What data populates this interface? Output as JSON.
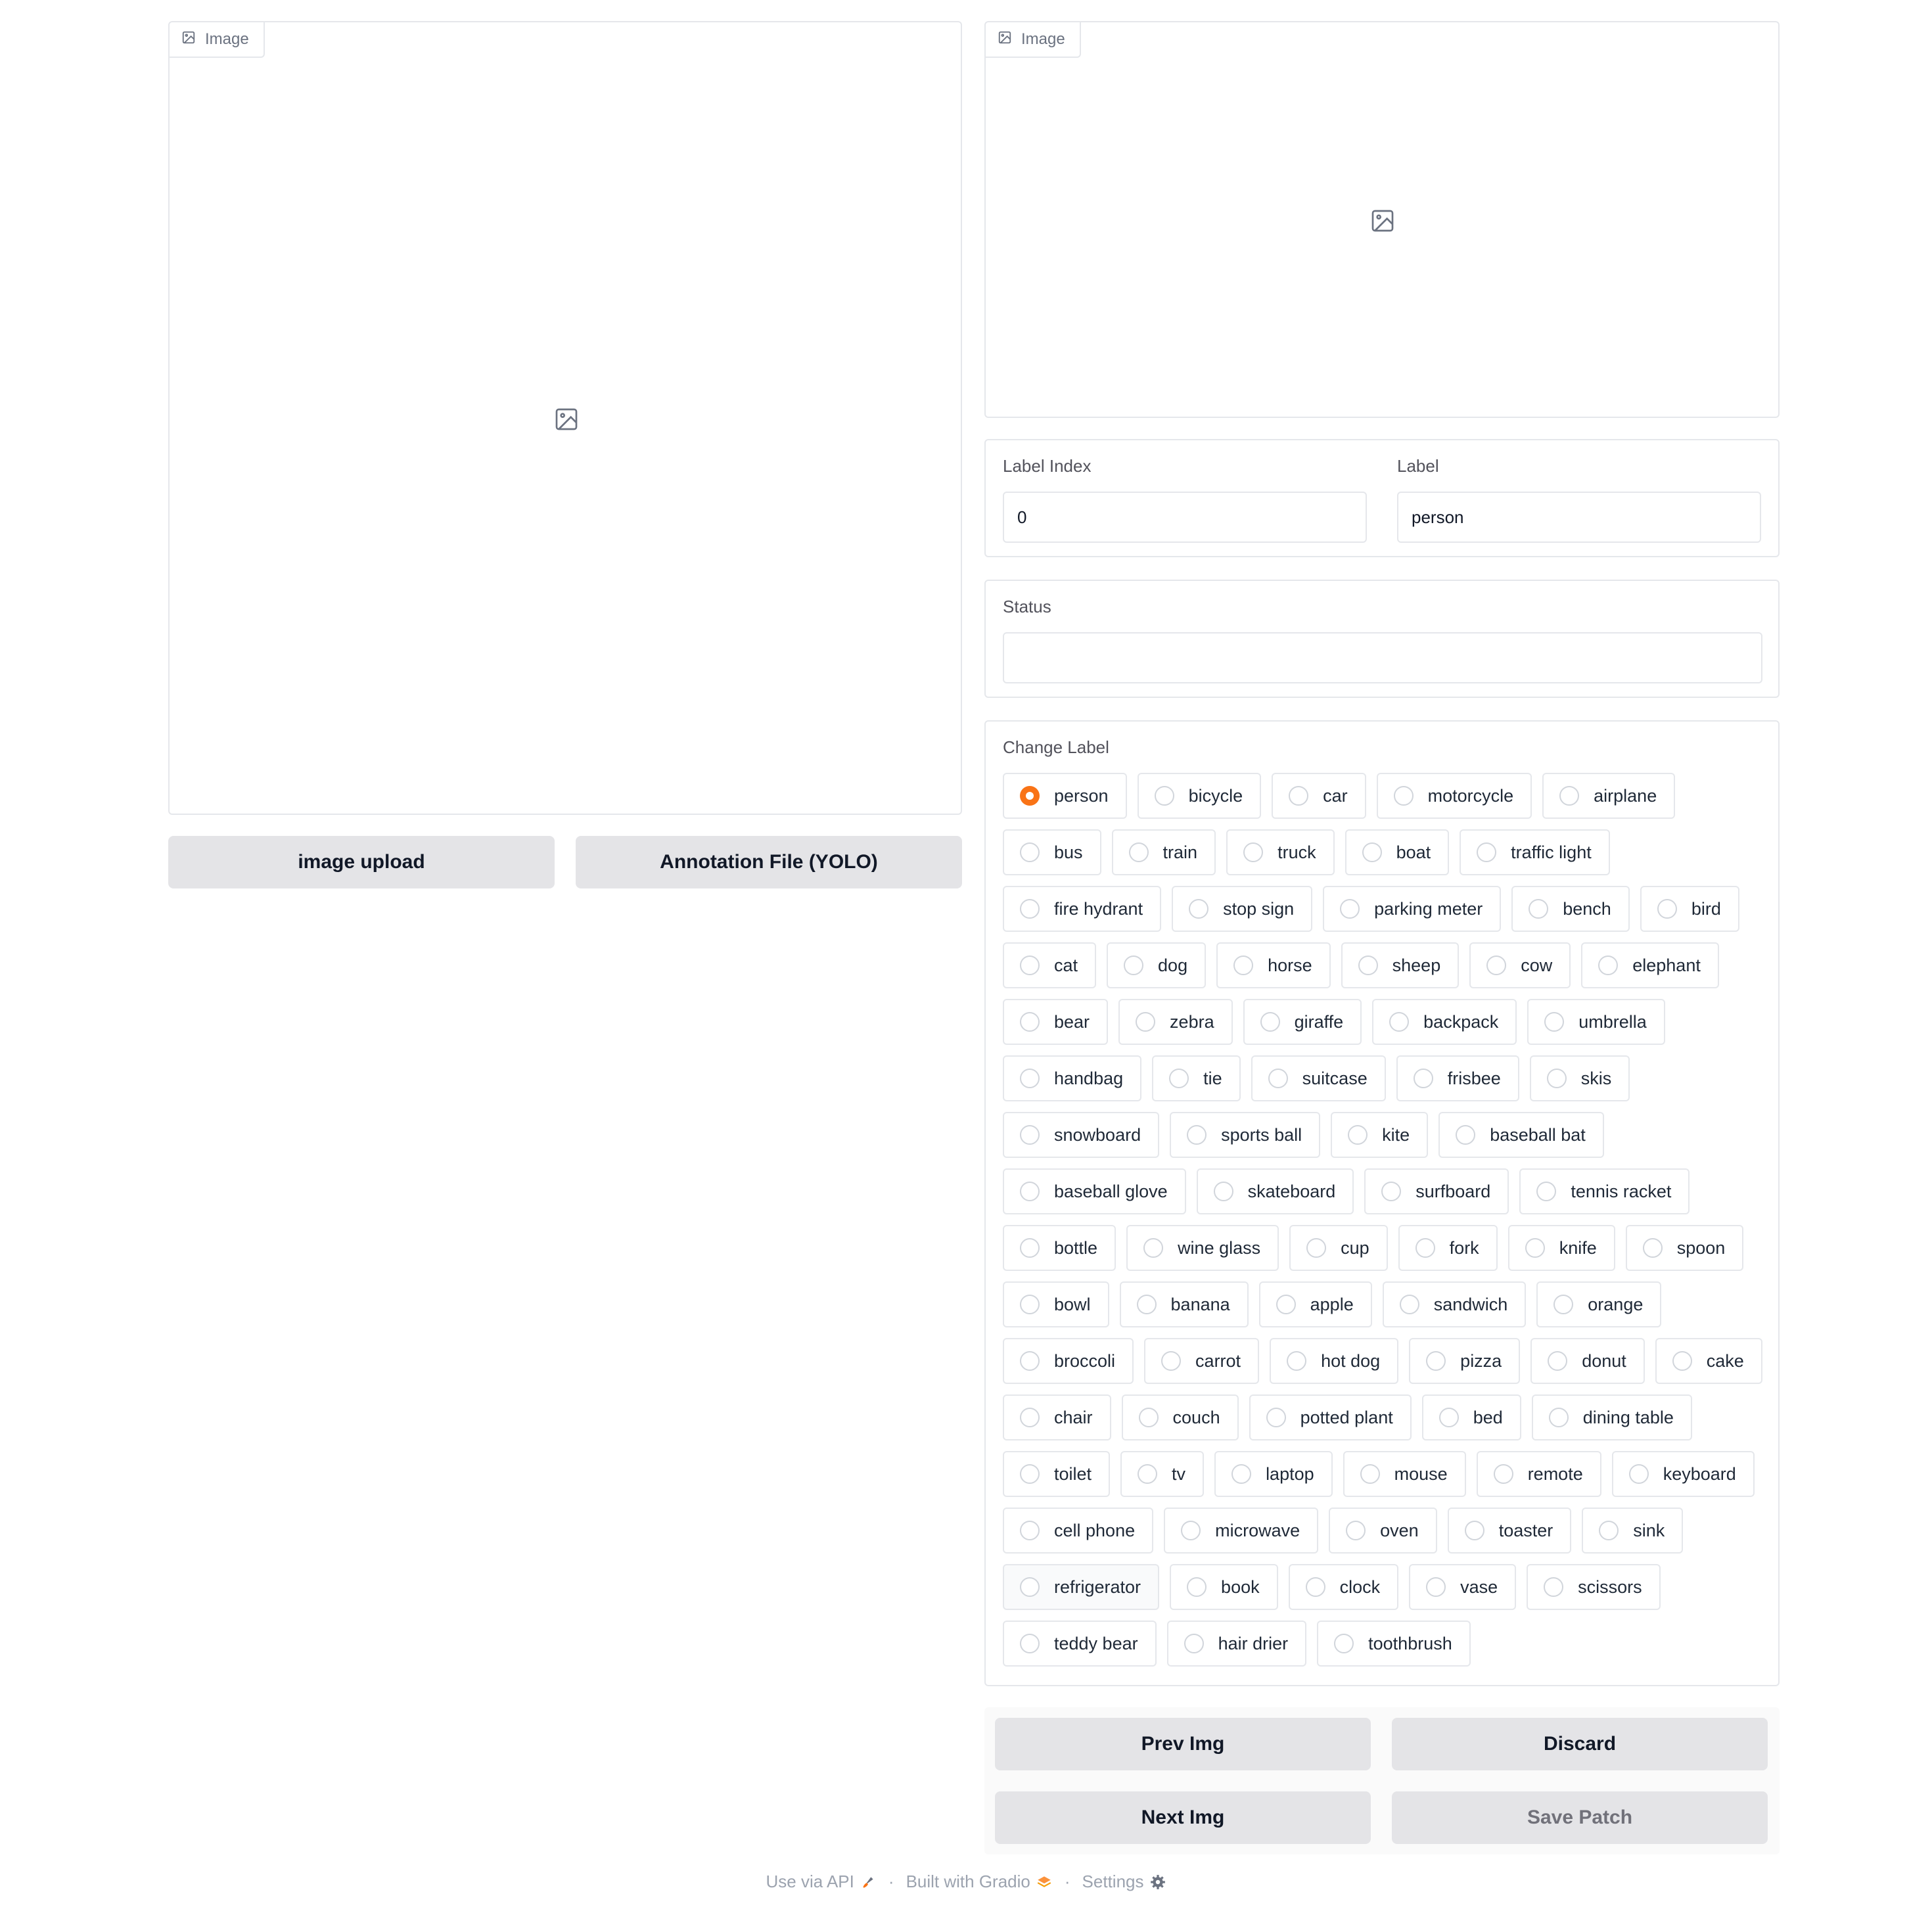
{
  "left_image": {
    "tag_label": "Image"
  },
  "right_image": {
    "tag_label": "Image"
  },
  "upload": {
    "image_upload_label": "image upload",
    "annotation_label": "Annotation File (YOLO)"
  },
  "label_index": {
    "label": "Label Index",
    "value": "0"
  },
  "label": {
    "label": "Label",
    "value": "person"
  },
  "status": {
    "label": "Status",
    "value": ""
  },
  "change_label": {
    "label": "Change Label",
    "selected": "person",
    "rows": [
      [
        "person",
        "bicycle",
        "car",
        "motorcycle",
        "airplane"
      ],
      [
        "bus",
        "train",
        "truck",
        "boat",
        "traffic light"
      ],
      [
        "fire hydrant",
        "stop sign",
        "parking meter",
        "bench",
        "bird"
      ],
      [
        "cat",
        "dog",
        "horse",
        "sheep",
        "cow",
        "elephant"
      ],
      [
        "bear",
        "zebra",
        "giraffe",
        "backpack",
        "umbrella"
      ],
      [
        "handbag",
        "tie",
        "suitcase",
        "frisbee",
        "skis"
      ],
      [
        "snowboard",
        "sports ball",
        "kite",
        "baseball bat"
      ],
      [
        "baseball glove",
        "skateboard",
        "surfboard",
        "tennis racket"
      ],
      [
        "bottle",
        "wine glass",
        "cup",
        "fork",
        "knife",
        "spoon"
      ],
      [
        "bowl",
        "banana",
        "apple",
        "sandwich",
        "orange"
      ],
      [
        "broccoli",
        "carrot",
        "hot dog",
        "pizza",
        "donut",
        "cake"
      ],
      [
        "chair",
        "couch",
        "potted plant",
        "bed",
        "dining table"
      ],
      [
        "toilet",
        "tv",
        "laptop",
        "mouse",
        "remote",
        "keyboard"
      ],
      [
        "cell phone",
        "microwave",
        "oven",
        "toaster",
        "sink"
      ],
      [
        "refrigerator",
        "book",
        "clock",
        "vase",
        "scissors"
      ],
      [
        "teddy bear",
        "hair drier",
        "toothbrush"
      ]
    ]
  },
  "actions": {
    "prev_label": "Prev Img",
    "discard_label": "Discard",
    "next_label": "Next Img",
    "save_label": "Save Patch"
  },
  "footer": {
    "api_label": "Use via API",
    "built_label": "Built with Gradio",
    "settings_label": "Settings",
    "separator": "·"
  }
}
